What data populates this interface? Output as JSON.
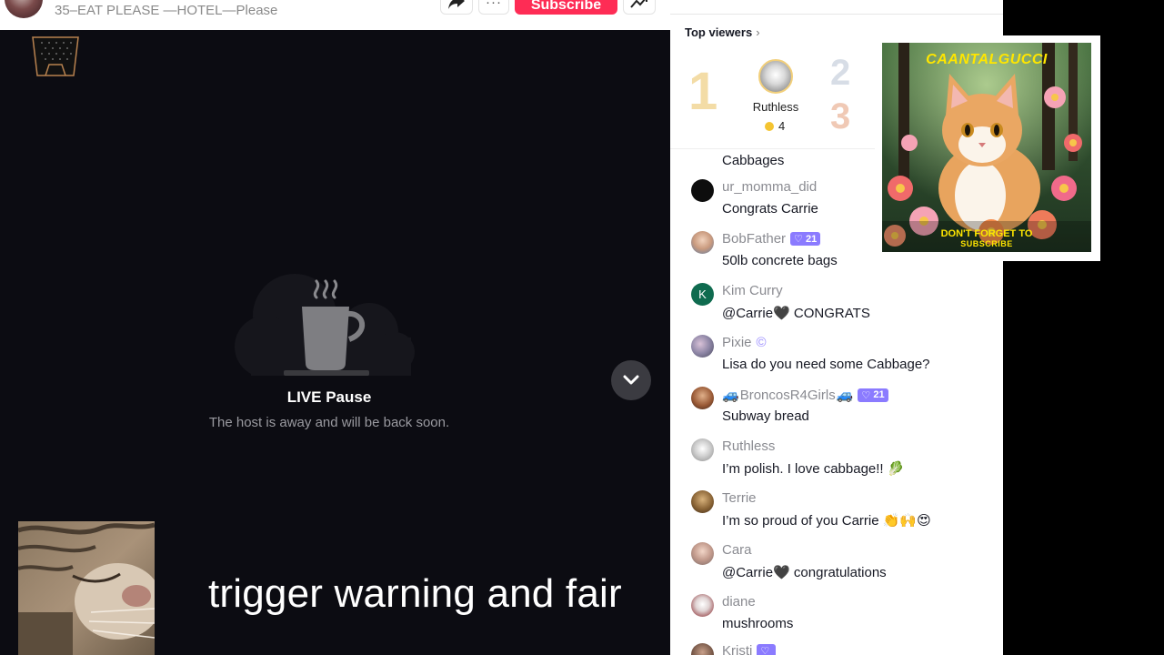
{
  "header": {
    "stream_title": "35–EAT PLEASE —HOTEL—Please",
    "subscribe_label": "Subscribe",
    "more_label": "···"
  },
  "player": {
    "pause_title": "LIVE Pause",
    "pause_subtitle": "The host is away and will be back soon.",
    "caption": "trigger warning and fair"
  },
  "chat": {
    "top_viewers_label": "Top viewers",
    "top_viewers_chevron": "›",
    "rank1": {
      "rank": "1",
      "name": "Ruthless",
      "score": "4"
    },
    "rank2": "2",
    "rank3": "3",
    "messages": [
      {
        "user": "",
        "text": "Cabbages"
      },
      {
        "user": "ur_momma_did",
        "text": "Congrats Carrie"
      },
      {
        "user": "BobFather",
        "badge": "21",
        "text": "50lb concrete bags"
      },
      {
        "user": "Kim Curry",
        "avatar_letter": "K",
        "text_before": "@Carrie",
        "text_after": " CONGRATS"
      },
      {
        "user": "Pixie",
        "text": "Lisa do you need some Cabbage?"
      },
      {
        "user": "BroncosR4Girls",
        "badge": "21",
        "text": "Subway bread"
      },
      {
        "user": "Ruthless",
        "text": "I’m polish. I love cabbage!! 🥬"
      },
      {
        "user": "Terrie",
        "text": "I’m so proud of you Carrie 👏🙌😍"
      },
      {
        "user": "Cara",
        "text_before": "@Carrie",
        "text_after": " congratulations"
      },
      {
        "user": "diane",
        "text": "mushrooms"
      },
      {
        "user": "Kristi",
        "badge": ""
      }
    ],
    "heart_glyph": "🖤",
    "pixie_mark": "©"
  },
  "poster": {
    "brand": "CAANTALGUCCI",
    "cta_line1": "DON'T FORGET TO",
    "cta_line2": "SUBSCRIBE"
  },
  "colors": {
    "accent": "#fe2c55",
    "player_bg": "#0c0c12",
    "badge": "#8b7bff"
  }
}
